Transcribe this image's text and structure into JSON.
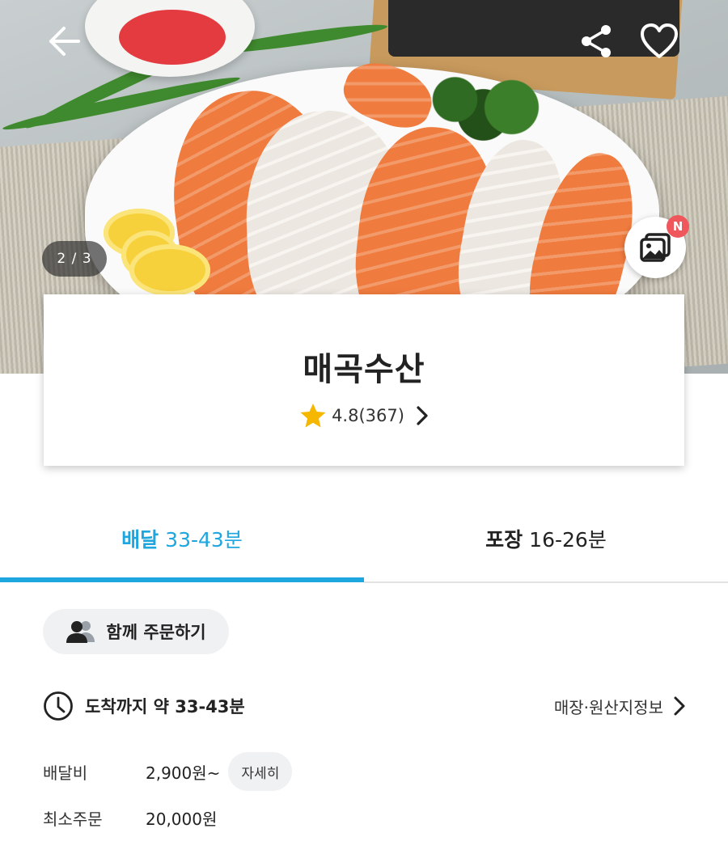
{
  "hero": {
    "photo_counter": "2 / 3",
    "gallery_badge": "N"
  },
  "store": {
    "name": "매곡수산",
    "rating": "4.8",
    "review_count": "(367)"
  },
  "tabs": [
    {
      "label": "배달",
      "time": "33-43분",
      "active": true
    },
    {
      "label": "포장",
      "time": "16-26분",
      "active": false
    }
  ],
  "group_order": {
    "label": "함께 주문하기"
  },
  "eta": {
    "text": "도착까지 약 33-43분",
    "store_info_link": "매장·원산지정보"
  },
  "delivery_fee": {
    "label": "배달비",
    "value": "2,900원~",
    "detail_button": "자세히"
  },
  "min_order": {
    "label": "최소주문",
    "value": "20,000원"
  },
  "colors": {
    "accent": "#1ea6de",
    "star": "#f5b700",
    "badge": "#f0575c"
  },
  "icons": [
    "back-arrow-icon",
    "share-icon",
    "heart-icon",
    "gallery-icon",
    "star-icon",
    "chevron-right-icon",
    "people-icon",
    "clock-icon"
  ]
}
